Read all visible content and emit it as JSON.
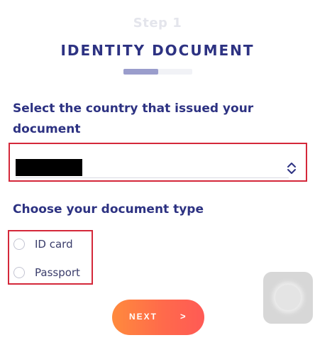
{
  "header": {
    "step_label": "Step 1",
    "title": "IDENTITY DOCUMENT",
    "progress_fraction": 0.5
  },
  "country_section": {
    "label": "Select the country that issued your document",
    "selected_value": ""
  },
  "doctype_section": {
    "label": "Choose your document type",
    "options": [
      {
        "label": "ID card",
        "selected": false
      },
      {
        "label": "Passport",
        "selected": false
      }
    ]
  },
  "actions": {
    "next_label": "NEXT",
    "next_arrow": ">"
  },
  "colors": {
    "title": "#2d3282",
    "button_gradient_start": "#ff8a3d",
    "button_gradient_end": "#ff5a55",
    "highlight_border": "#d4283a"
  }
}
